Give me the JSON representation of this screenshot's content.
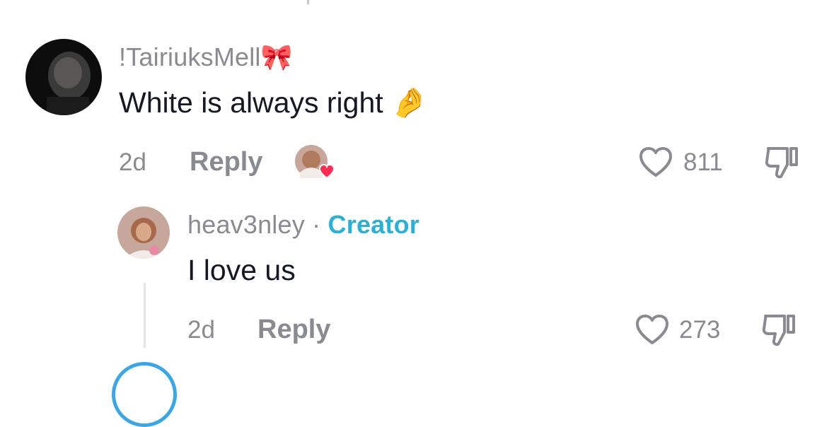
{
  "comments": [
    {
      "username": "!TairiuksMell",
      "username_emoji": "🎀",
      "text": "White is always right",
      "text_emoji": "🤌",
      "age": "2d",
      "reply_label": "Reply",
      "likes": "811",
      "creator_liked": true
    },
    {
      "username": "heav3nley",
      "separator": "·",
      "badge": "Creator",
      "text": "I love us",
      "age": "2d",
      "reply_label": "Reply",
      "likes": "273"
    }
  ],
  "colors": {
    "creator_badge": "#2bb0d6",
    "liked_heart": "#fe2c55",
    "secondary_text": "#8a8b91"
  },
  "icons": [
    "heart-outline-icon",
    "dislike-icon",
    "heart-filled-icon"
  ]
}
